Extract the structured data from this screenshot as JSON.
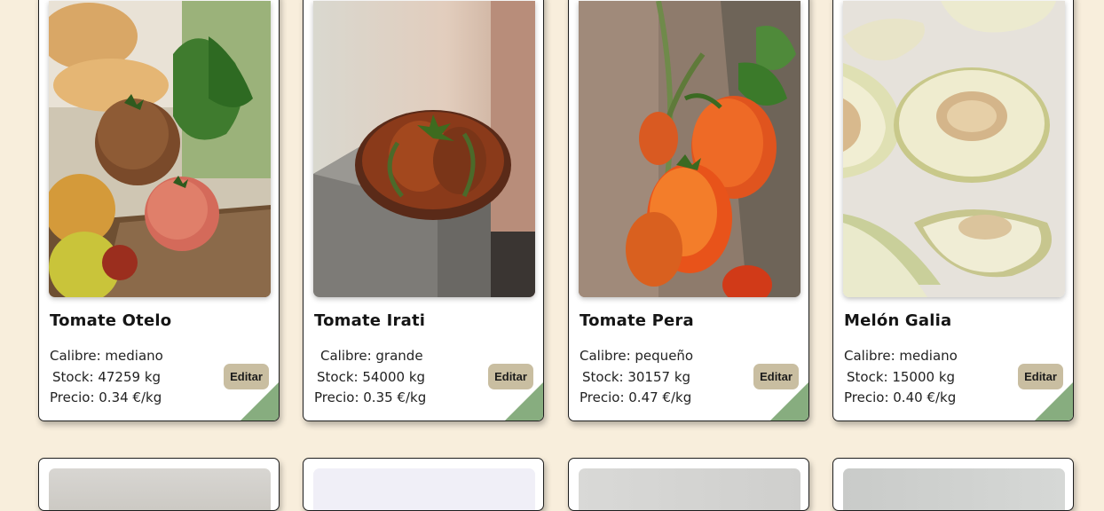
{
  "edit_label": "Editar",
  "accent_corner_color": "#87ad7f",
  "edit_button_color": "#c9bea1",
  "page_background": "#f8eedc",
  "products": [
    {
      "name": "Tomate Otelo",
      "calibre": "Calibre: mediano",
      "stock": "Stock: 47259 kg",
      "precio": "Precio: 0.34 €/kg"
    },
    {
      "name": "Tomate Irati",
      "calibre": "Calibre: grande",
      "stock": "Stock: 54000 kg",
      "precio": "Precio: 0.35 €/kg"
    },
    {
      "name": "Tomate Pera",
      "calibre": "Calibre: pequeño",
      "stock": "Stock: 30157 kg",
      "precio": "Precio: 0.47 €/kg"
    },
    {
      "name": "Melón Galia",
      "calibre": "Calibre: mediano",
      "stock": "Stock: 15000 kg",
      "precio": "Precio: 0.40 €/kg"
    }
  ]
}
